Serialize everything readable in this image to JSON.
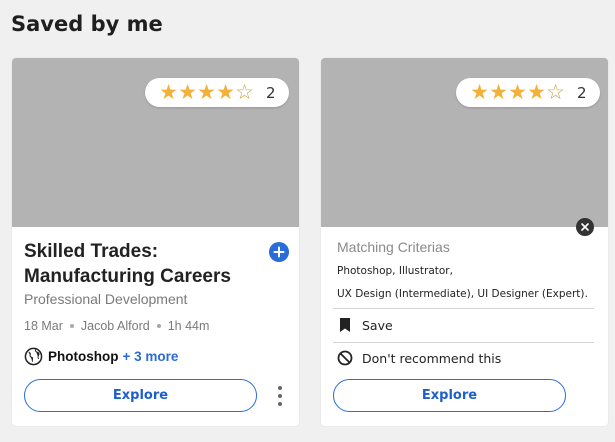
{
  "section": {
    "title": "Saved by me"
  },
  "cards": [
    {
      "rating_stars": 4,
      "rating_count": "2",
      "title": "Skilled Trades: Manufacturing Careers",
      "category": "Professional Development",
      "meta": {
        "date": "18 Mar",
        "author": "Jacob Alford",
        "duration": "1h 44m"
      },
      "skills": {
        "main": "Photoshop",
        "more": "+ 3 more"
      },
      "explore_label": "Explore"
    },
    {
      "rating_stars": 4,
      "rating_count": "2",
      "matching": {
        "title": "Matching Criterias",
        "line1": "Photoshop, Illustrator,",
        "line2": "UX Design (Intermediate), UI Designer (Expert)…"
      },
      "menu": {
        "save_label": "Save",
        "dont_recommend_label": "Don't recommend this"
      },
      "explore_label": "Explore"
    }
  ],
  "colors": {
    "accent": "#2a6cd8",
    "star": "#f2b13b",
    "thumbnail": "#b3b3b3"
  },
  "icons": [
    "star-icon",
    "add-circle-icon",
    "globe-icon",
    "more-vertical-icon",
    "close-circle-icon",
    "bookmark-icon",
    "block-icon"
  ]
}
